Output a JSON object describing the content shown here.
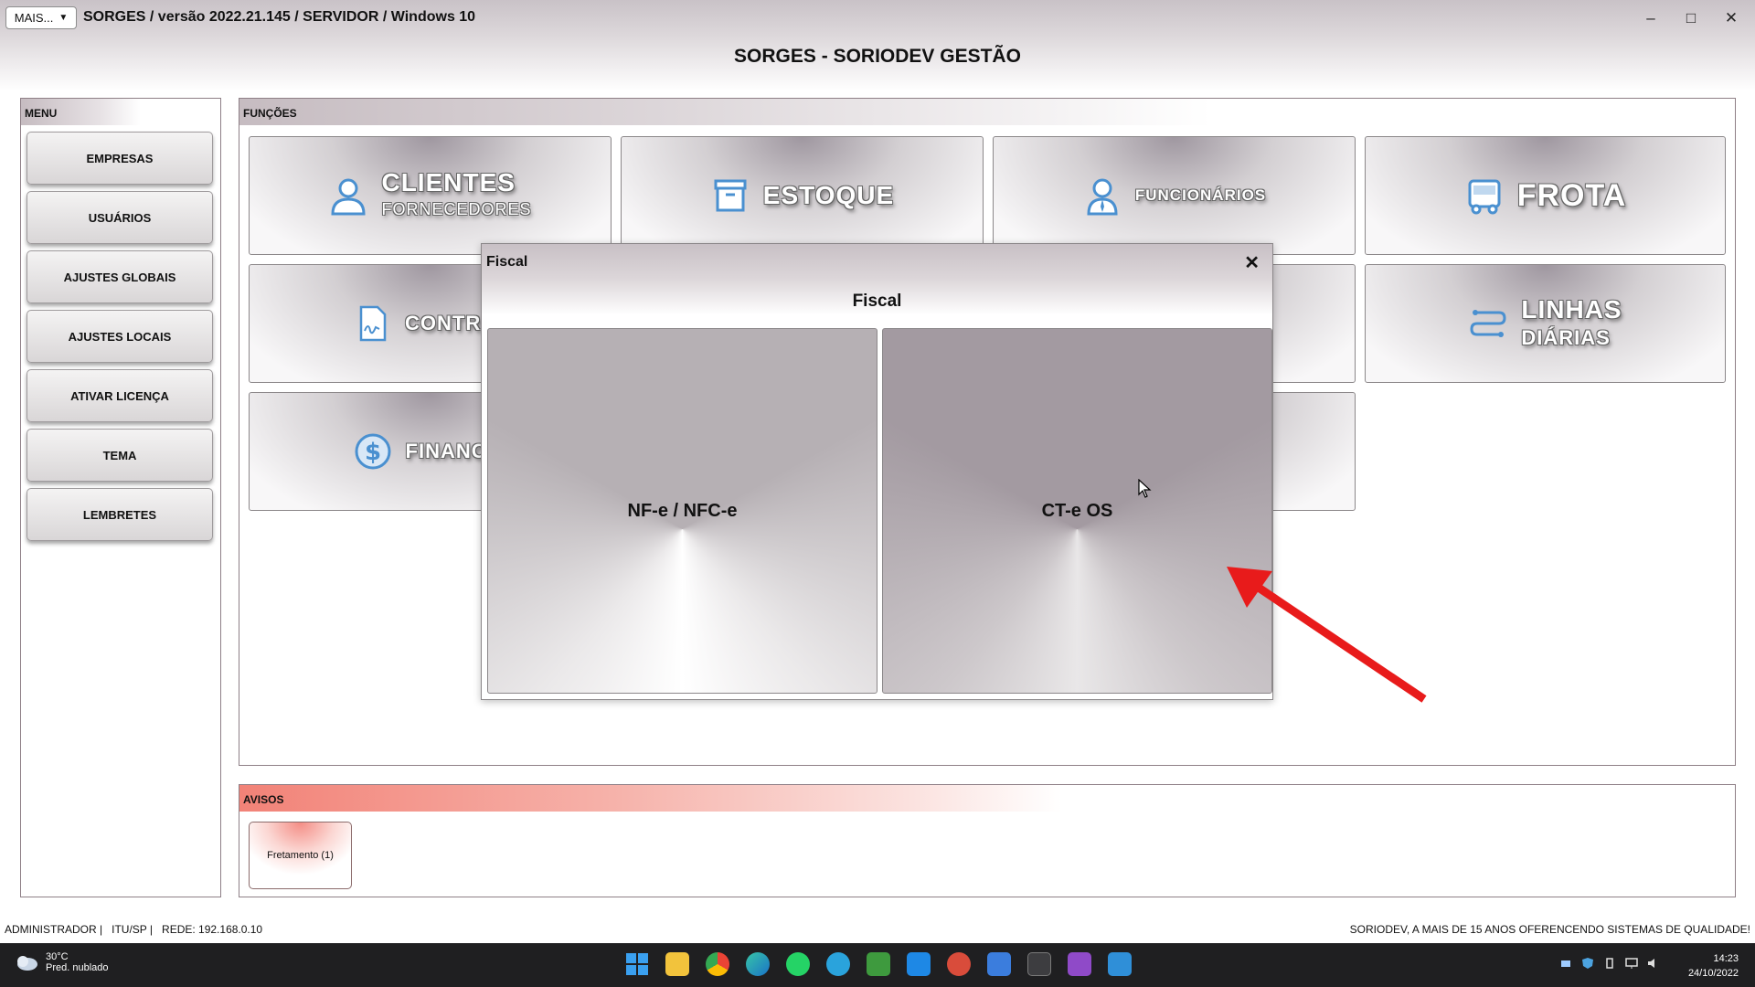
{
  "window": {
    "mais_label": "MAIS...",
    "title": "SORGES / versão 2022.21.145 / SERVIDOR / Windows 10",
    "minimize": "–",
    "maximize": "□",
    "close": "✕"
  },
  "header": {
    "title": "SORGES - SORIODEV GESTÃO"
  },
  "menu": {
    "header": "MENU",
    "items": [
      "EMPRESAS",
      "USUÁRIOS",
      "AJUSTES GLOBAIS",
      "AJUSTES LOCAIS",
      "ATIVAR LICENÇA",
      "TEMA",
      "LEMBRETES"
    ]
  },
  "funcoes": {
    "header": "FUNÇÕES",
    "tiles": {
      "clientes": {
        "label": "CLIENTES",
        "sub": "FORNECEDORES",
        "icon": "person-icon"
      },
      "estoque": {
        "label": "ESTOQUE",
        "icon": "box-icon"
      },
      "funcionarios": {
        "label": "FUNCIONÁRIOS",
        "icon": "employee-icon"
      },
      "frota": {
        "label": "FROTA",
        "icon": "bus-icon"
      },
      "contratos": {
        "label": "CONTRAT",
        "icon": "contract-icon"
      },
      "linhas": {
        "label": "LINHAS",
        "sub": "DIÁRIAS",
        "icon": "route-icon"
      },
      "financeiro": {
        "label": "FINANCEI",
        "icon": "dollar-icon"
      }
    }
  },
  "avisos": {
    "header": "AVISOS",
    "button": "Fretamento (1)"
  },
  "status": {
    "left": "ADMINISTRADOR |   ITU/SP |   REDE: 192.168.0.10",
    "right": "SORIODEV, A MAIS DE 15 ANOS OFERENCENDO SISTEMAS DE QUALIDADE!"
  },
  "modal": {
    "title": "Fiscal",
    "close": "✕",
    "heading": "Fiscal",
    "buttons": [
      "NF-e / NFC-e",
      "CT-e OS"
    ]
  },
  "taskbar": {
    "temp": "30°C",
    "weather": "Pred. nublado",
    "time": "14:23",
    "date": "24/10/2022"
  },
  "colors": {
    "accent_red": "#e81b1b",
    "icon_blue": "#4a90d0",
    "avisos_red": "#f28277"
  }
}
